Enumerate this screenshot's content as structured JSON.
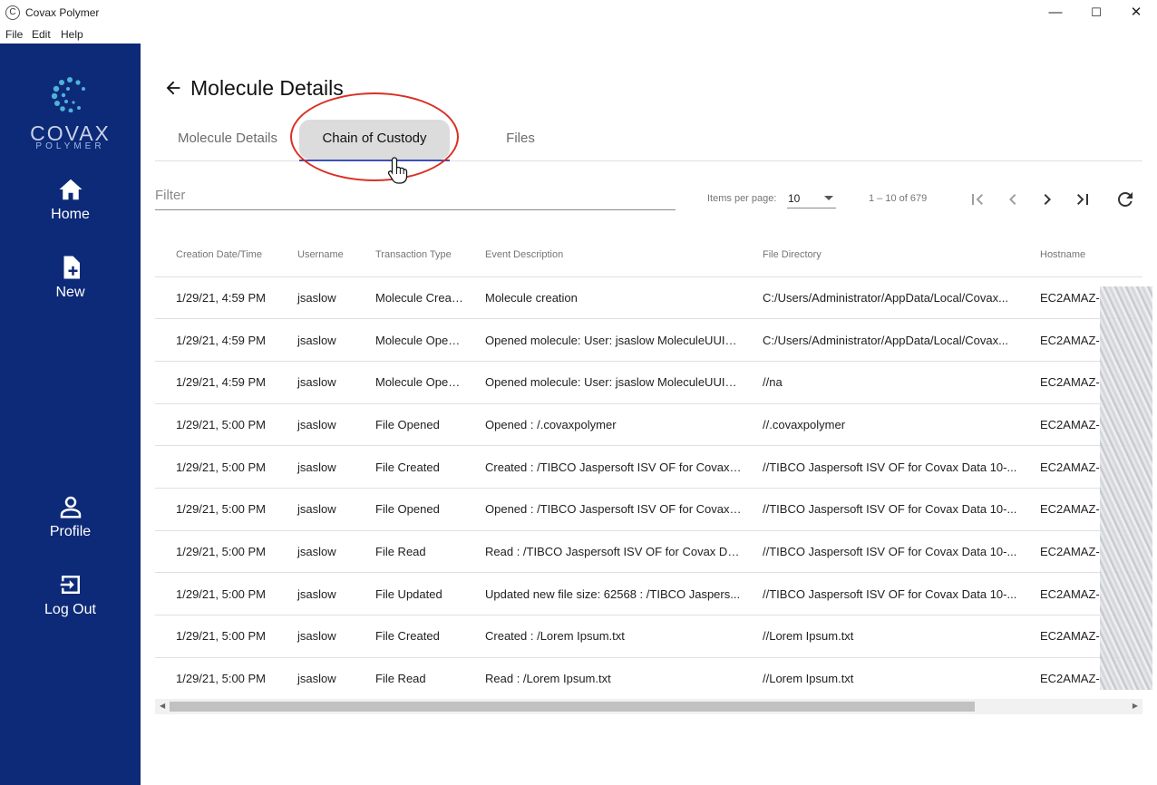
{
  "window": {
    "title": "Covax Polymer",
    "minimize": "—",
    "maximize": "☐",
    "close": "✕"
  },
  "menu": [
    "File",
    "Edit",
    "Help"
  ],
  "logo": {
    "name": "COVAX",
    "sub": "POLYMER"
  },
  "sidebar": {
    "items": [
      {
        "label": "Home",
        "icon": "home-icon"
      },
      {
        "label": "New",
        "icon": "new-file-icon"
      },
      {
        "label": "Profile",
        "icon": "profile-icon"
      },
      {
        "label": "Log Out",
        "icon": "logout-icon"
      }
    ]
  },
  "page": {
    "title": "Molecule Details"
  },
  "tabs": [
    {
      "label": "Molecule Details",
      "active": false
    },
    {
      "label": "Chain of Custody",
      "active": true
    },
    {
      "label": "Files",
      "active": false
    }
  ],
  "filter": {
    "placeholder": "Filter"
  },
  "pagination": {
    "items_label": "Items per page:",
    "page_size": "10",
    "range": "1 – 10 of 679"
  },
  "colors": {
    "sidebar": "#0d2a78",
    "accent": "#3f51b5",
    "annotation": "#d93025"
  },
  "table": {
    "headers": [
      "Creation Date/Time",
      "Username",
      "Transaction Type",
      "Event Description",
      "File Directory",
      "Hostname"
    ],
    "rows": [
      [
        "1/29/21, 4:59 PM",
        "jsaslow",
        "Molecule Created",
        "Molecule creation",
        "C:/Users/Administrator/AppData/Local/Covax...",
        "EC2AMAZ-"
      ],
      [
        "1/29/21, 4:59 PM",
        "jsaslow",
        "Molecule Opened",
        "Opened molecule: User: jsaslow MoleculeUUID...",
        "C:/Users/Administrator/AppData/Local/Covax...",
        "EC2AMAZ-"
      ],
      [
        "1/29/21, 4:59 PM",
        "jsaslow",
        "Molecule Opened",
        "Opened molecule: User: jsaslow MoleculeUUID...",
        "//na",
        "EC2AMAZ-"
      ],
      [
        "1/29/21, 5:00 PM",
        "jsaslow",
        "File Opened",
        "Opened : /.covaxpolymer",
        "//.covaxpolymer",
        "EC2AMAZ-"
      ],
      [
        "1/29/21, 5:00 PM",
        "jsaslow",
        "File Created",
        "Created : /TIBCO Jaspersoft ISV OF for Covax ...",
        "//TIBCO Jaspersoft ISV OF for Covax Data 10-...",
        "EC2AMAZ-"
      ],
      [
        "1/29/21, 5:00 PM",
        "jsaslow",
        "File Opened",
        "Opened : /TIBCO Jaspersoft ISV OF for Covax ...",
        "//TIBCO Jaspersoft ISV OF for Covax Data 10-...",
        "EC2AMAZ-"
      ],
      [
        "1/29/21, 5:00 PM",
        "jsaslow",
        "File Read",
        "Read : /TIBCO Jaspersoft ISV OF for Covax Da...",
        "//TIBCO Jaspersoft ISV OF for Covax Data 10-...",
        "EC2AMAZ-"
      ],
      [
        "1/29/21, 5:00 PM",
        "jsaslow",
        "File Updated",
        "Updated new file size: 62568 : /TIBCO Jaspers...",
        "//TIBCO Jaspersoft ISV OF for Covax Data 10-...",
        "EC2AMAZ-"
      ],
      [
        "1/29/21, 5:00 PM",
        "jsaslow",
        "File Created",
        "Created : /Lorem Ipsum.txt",
        "//Lorem Ipsum.txt",
        "EC2AMAZ-"
      ],
      [
        "1/29/21, 5:00 PM",
        "jsaslow",
        "File Read",
        "Read : /Lorem Ipsum.txt",
        "//Lorem Ipsum.txt",
        "EC2AMAZ-"
      ]
    ]
  }
}
